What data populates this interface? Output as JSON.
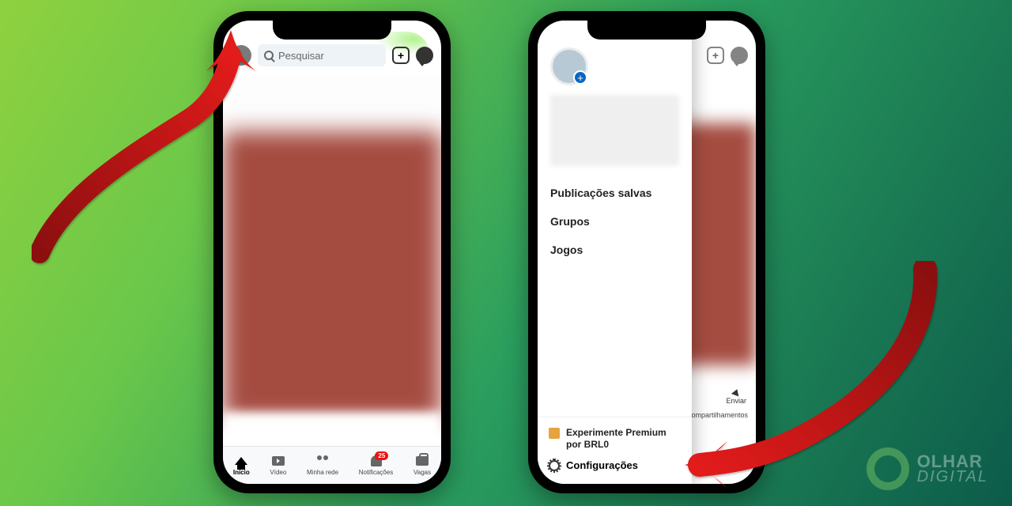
{
  "phone1": {
    "search_placeholder": "Pesquisar",
    "nav": {
      "home": "Início",
      "video": "Vídeo",
      "network": "Minha rede",
      "notifications": "Notificações",
      "jobs": "Vagas",
      "badge": "25"
    }
  },
  "phone2": {
    "menu": {
      "saved": "Publicações salvas",
      "groups": "Grupos",
      "games": "Jogos"
    },
    "premium_line1": "Experimente Premium",
    "premium_line2": "por BRL0",
    "settings": "Configurações",
    "shares_hint": "compartilhamentos",
    "send_label": "Enviar"
  },
  "watermark": {
    "line1": "OLHAR",
    "line2": "DIGITAL"
  }
}
